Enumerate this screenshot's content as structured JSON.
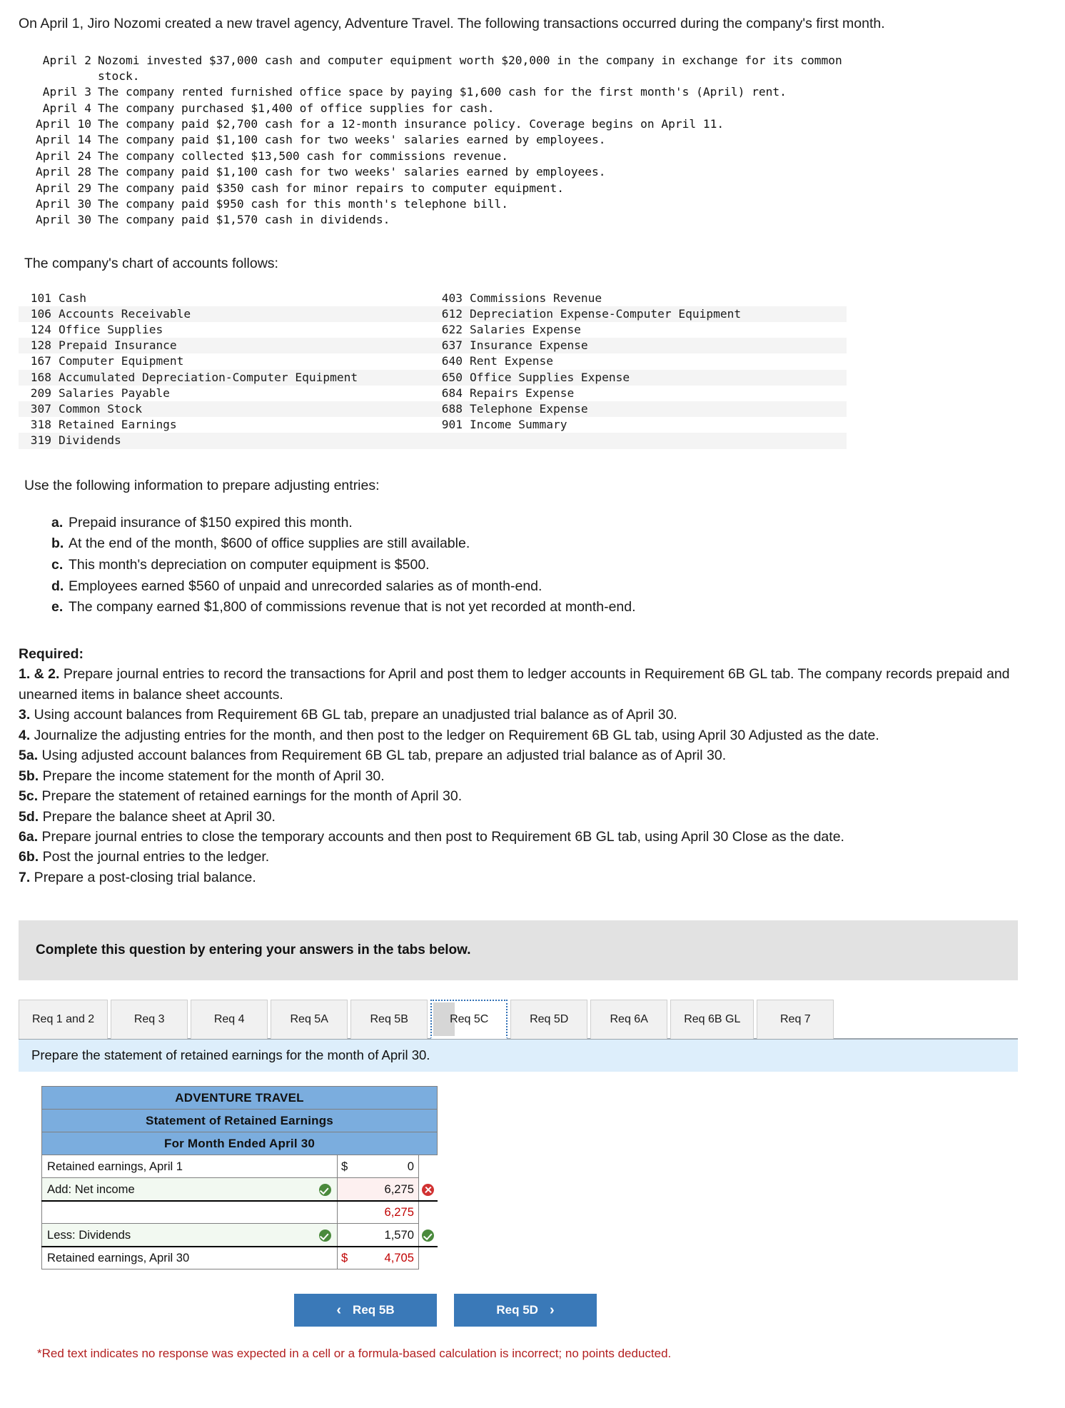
{
  "intro": {
    "paragraph": "On April 1, Jiro Nozomi created a new travel agency, Adventure Travel. The following transactions occurred during the company's first month."
  },
  "transactions": [
    {
      "date": "April 2",
      "desc": "Nozomi invested $37,000 cash and computer equipment worth $20,000 in the company in exchange for its common",
      "cont": "stock."
    },
    {
      "date": "April 3",
      "desc": "The company rented furnished office space by paying $1,600 cash for the first month's (April) rent.",
      "cont": ""
    },
    {
      "date": "April 4",
      "desc": "The company purchased $1,400 of office supplies for cash.",
      "cont": ""
    },
    {
      "date": "April 10",
      "desc": "The company paid $2,700 cash for a 12-month insurance policy. Coverage begins on April 11.",
      "cont": ""
    },
    {
      "date": "April 14",
      "desc": "The company paid $1,100 cash for two weeks' salaries earned by employees.",
      "cont": ""
    },
    {
      "date": "April 24",
      "desc": "The company collected $13,500 cash for commissions revenue.",
      "cont": ""
    },
    {
      "date": "April 28",
      "desc": "The company paid $1,100 cash for two weeks' salaries earned by employees.",
      "cont": ""
    },
    {
      "date": "April 29",
      "desc": "The company paid $350 cash for minor repairs to computer equipment.",
      "cont": ""
    },
    {
      "date": "April 30",
      "desc": "The company paid $950 cash for this month's telephone bill.",
      "cont": ""
    },
    {
      "date": "April 30",
      "desc": "The company paid $1,570 cash in dividends.",
      "cont": ""
    }
  ],
  "chart_of_accounts": {
    "lead": "The company's chart of accounts follows:",
    "rows": [
      {
        "left_num": "101",
        "left_name": "Cash",
        "right_num": "403",
        "right_name": "Commissions Revenue"
      },
      {
        "left_num": "106",
        "left_name": "Accounts Receivable",
        "right_num": "612",
        "right_name": "Depreciation Expense-Computer Equipment"
      },
      {
        "left_num": "124",
        "left_name": "Office Supplies",
        "right_num": "622",
        "right_name": "Salaries Expense"
      },
      {
        "left_num": "128",
        "left_name": "Prepaid Insurance",
        "right_num": "637",
        "right_name": "Insurance Expense"
      },
      {
        "left_num": "167",
        "left_name": "Computer Equipment",
        "right_num": "640",
        "right_name": "Rent Expense"
      },
      {
        "left_num": "168",
        "left_name": "Accumulated Depreciation-Computer Equipment",
        "right_num": "650",
        "right_name": "Office Supplies Expense"
      },
      {
        "left_num": "209",
        "left_name": "Salaries Payable",
        "right_num": "684",
        "right_name": "Repairs Expense"
      },
      {
        "left_num": "307",
        "left_name": "Common Stock",
        "right_num": "688",
        "right_name": "Telephone Expense"
      },
      {
        "left_num": "318",
        "left_name": "Retained Earnings",
        "right_num": "901",
        "right_name": "Income Summary"
      },
      {
        "left_num": "319",
        "left_name": "Dividends",
        "right_num": "",
        "right_name": ""
      }
    ]
  },
  "adjusting": {
    "lead": "Use the following information to prepare adjusting entries:",
    "items": [
      {
        "label": "a.",
        "text": "Prepaid insurance of $150 expired this month."
      },
      {
        "label": "b.",
        "text": "At the end of the month, $600 of office supplies are still available."
      },
      {
        "label": "c.",
        "text": "This month's depreciation on computer equipment is $500."
      },
      {
        "label": "d.",
        "text": "Employees earned $560 of unpaid and unrecorded salaries as of month-end."
      },
      {
        "label": "e.",
        "text": "The company earned $1,800 of commissions revenue that is not yet recorded at month-end."
      }
    ]
  },
  "required": {
    "heading": "Required:",
    "lines": [
      {
        "num": "1. & 2.",
        "text": " Prepare journal entries to record the transactions for April and post them to ledger accounts in Requirement 6B GL tab. The company records prepaid and unearned items in balance sheet accounts."
      },
      {
        "num": "3.",
        "text": " Using account balances from Requirement 6B GL tab, prepare an unadjusted trial balance as of April 30."
      },
      {
        "num": "4.",
        "text": " Journalize the adjusting entries for the month, and then post to the ledger on Requirement 6B GL tab, using April 30 Adjusted as the date."
      },
      {
        "num": "5a.",
        "text": " Using adjusted account balances from Requirement 6B GL tab, prepare an adjusted trial balance as of April 30."
      },
      {
        "num": "5b.",
        "text": " Prepare the income statement for the month of April 30."
      },
      {
        "num": "5c.",
        "text": " Prepare the statement of retained earnings for the month of April 30."
      },
      {
        "num": "5d.",
        "text": " Prepare the balance sheet at April 30."
      },
      {
        "num": "6a.",
        "text": " Prepare journal entries to close the temporary accounts and then post to Requirement 6B GL tab, using April 30 Close as the date."
      },
      {
        "num": "6b.",
        "text": " Post the journal entries to the ledger."
      },
      {
        "num": "7.",
        "text": " Prepare a post-closing trial balance."
      }
    ]
  },
  "banner": {
    "text": "Complete this question by entering your answers in the tabs below."
  },
  "tabs": [
    {
      "label": "Req 1 and 2",
      "active": false
    },
    {
      "label": "Req 3",
      "active": false
    },
    {
      "label": "Req 4",
      "active": false
    },
    {
      "label": "Req 5A",
      "active": false
    },
    {
      "label": "Req 5B",
      "active": false
    },
    {
      "label": "Req 5C",
      "active": true
    },
    {
      "label": "Req 5D",
      "active": false
    },
    {
      "label": "Req 6A",
      "active": false
    },
    {
      "label": "Req 6B GL",
      "active": false
    },
    {
      "label": "Req 7",
      "active": false
    }
  ],
  "sub_instruction": {
    "text": "Prepare the statement of retained earnings for the month of April 30."
  },
  "statement": {
    "title_line1": "ADVENTURE TRAVEL",
    "title_line2": "Statement of Retained Earnings",
    "title_line3": "For Month Ended April 30",
    "rows": [
      {
        "label": "Retained earnings, April 1",
        "flag": "",
        "dollar": "$",
        "amount": "0",
        "mark": "",
        "amount_color": "black",
        "amount_bg": "white",
        "label_bg": "white",
        "top_rule": false
      },
      {
        "label": "Add: Net income",
        "flag": "check",
        "dollar": "",
        "amount": "6,275",
        "mark": "x",
        "amount_color": "black",
        "amount_bg": "pink",
        "label_bg": "green",
        "top_rule": false
      },
      {
        "label": "",
        "flag": "",
        "dollar": "",
        "amount": "6,275",
        "mark": "",
        "amount_color": "red",
        "amount_bg": "white",
        "label_bg": "white",
        "top_rule": true
      },
      {
        "label": "Less: Dividends",
        "flag": "check",
        "dollar": "",
        "amount": "1,570",
        "mark": "check",
        "amount_color": "black",
        "amount_bg": "white",
        "label_bg": "green",
        "top_rule": false
      },
      {
        "label": "Retained earnings, April 30",
        "flag": "",
        "dollar": "$",
        "amount": "4,705",
        "mark": "",
        "amount_color": "red",
        "amount_bg": "white",
        "label_bg": "white",
        "top_rule": true
      }
    ]
  },
  "nav": {
    "prev_label": "Req 5B",
    "prev_chevron": "‹",
    "next_label": "Req 5D",
    "next_chevron": "›"
  },
  "footnote": {
    "text": "*Red text indicates no response was expected in a cell or a formula-based calculation is incorrect; no points deducted."
  }
}
